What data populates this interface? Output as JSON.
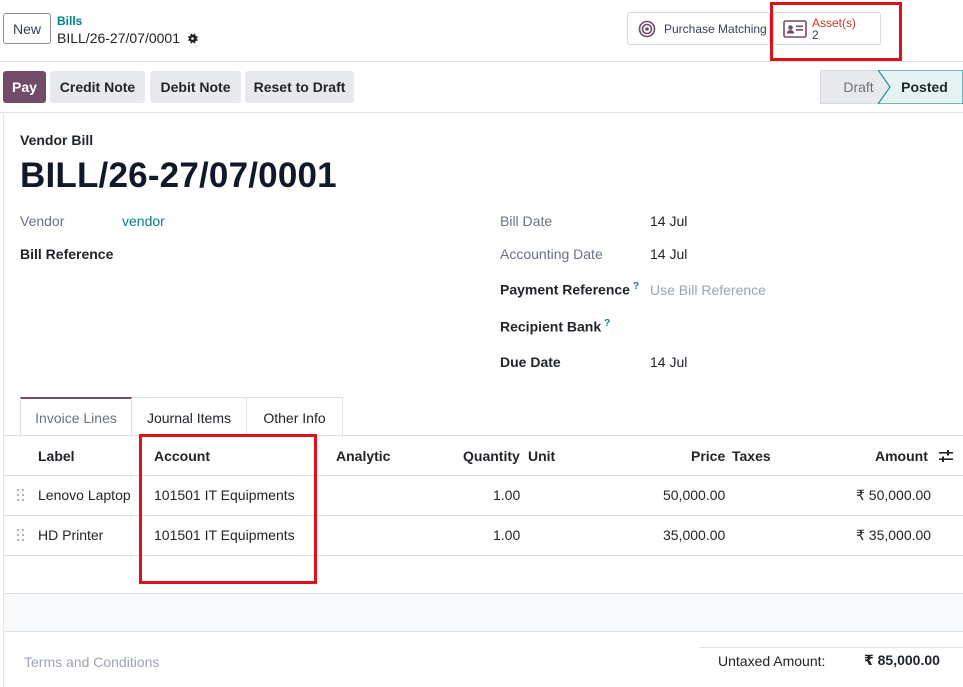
{
  "header": {
    "new_label": "New",
    "breadcrumb_parent": "Bills",
    "breadcrumb_current": "BILL/26-27/07/0001",
    "purchase_matching_label": "Purchase Matching",
    "assets_label": "Asset(s)",
    "assets_count": "2"
  },
  "actions": {
    "pay": "Pay",
    "credit_note": "Credit Note",
    "debit_note": "Debit Note",
    "reset_to_draft": "Reset to Draft"
  },
  "status": {
    "stages": [
      "Draft",
      "Posted"
    ],
    "active": "Posted"
  },
  "form": {
    "doc_type": "Vendor Bill",
    "doc_name": "BILL/26-27/07/0001",
    "vendor_label": "Vendor",
    "vendor_value": "vendor",
    "bill_reference_label": "Bill Reference",
    "bill_date_label": "Bill Date",
    "bill_date_value": "14 Jul",
    "accounting_date_label": "Accounting Date",
    "accounting_date_value": "14 Jul",
    "payment_reference_label": "Payment Reference",
    "payment_reference_placeholder": "Use Bill Reference",
    "recipient_bank_label": "Recipient Bank",
    "due_date_label": "Due Date",
    "due_date_value": "14 Jul",
    "tooltip_mark": "?"
  },
  "tabs": [
    "Invoice Lines",
    "Journal Items",
    "Other Info"
  ],
  "table": {
    "columns": {
      "label": "Label",
      "account": "Account",
      "analytic": "Analytic",
      "quantity": "Quantity",
      "unit": "Unit",
      "price": "Price",
      "taxes": "Taxes",
      "amount": "Amount"
    },
    "rows": [
      {
        "label": "Lenovo Laptop",
        "account": "101501 IT Equipments",
        "quantity": "1.00",
        "price": "50,000.00",
        "amount": "₹ 50,000.00"
      },
      {
        "label": "HD Printer",
        "account": "101501 IT Equipments",
        "quantity": "1.00",
        "price": "35,000.00",
        "amount": "₹ 35,000.00"
      }
    ]
  },
  "footer": {
    "terms_placeholder": "Terms and Conditions",
    "untaxed_label": "Untaxed Amount:",
    "untaxed_value": "₹ 85,000.00"
  },
  "colors": {
    "primary": "#714b67",
    "link": "#017e84",
    "highlight": "#e0101a"
  }
}
